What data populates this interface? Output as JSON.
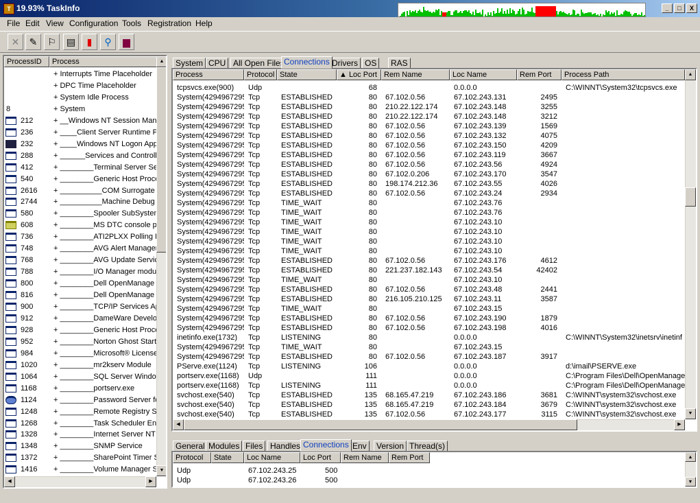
{
  "window": {
    "title": "19.93% TaskInfo",
    "icon": "app-icon",
    "min": "_",
    "max": "□",
    "close": "X"
  },
  "menu": [
    "File",
    "Edit",
    "View",
    "Configuration",
    "Tools",
    "Registration",
    "Help"
  ],
  "toolbar": [
    {
      "name": "close-x-icon",
      "glyph": "✕"
    },
    {
      "name": "pin-icon",
      "glyph": "✎"
    },
    {
      "name": "run-icon",
      "glyph": "⚐"
    },
    {
      "name": "properties-icon",
      "glyph": "▤"
    },
    {
      "name": "color-bars-icon",
      "glyph": "▮"
    },
    {
      "name": "search-icon",
      "glyph": "⚲"
    },
    {
      "name": "book-icon",
      "glyph": "▆"
    }
  ],
  "colors": {
    "graph_green": "#00c000",
    "graph_red": "#ff0000",
    "tab_active": "#1040c0"
  },
  "left": {
    "headers": [
      "ProcessID",
      "Process"
    ],
    "rows": [
      {
        "pid": "",
        "name": "+ Interrupts Time Placeholder",
        "icon": ""
      },
      {
        "pid": "",
        "name": "+ DPC Time Placeholder",
        "icon": ""
      },
      {
        "pid": "",
        "name": "+ System Idle Process",
        "icon": ""
      },
      {
        "pid": "8",
        "name": "+ System",
        "icon": ""
      },
      {
        "pid": "212",
        "name": "+ __Windows NT Session Mana",
        "icon": "window"
      },
      {
        "pid": "236",
        "name": "+ ____Client Server Runtime Pro",
        "icon": "window"
      },
      {
        "pid": "232",
        "name": "+ ____Windows NT Logon App",
        "icon": "lock"
      },
      {
        "pid": "288",
        "name": "+ ______Services and Controlle",
        "icon": "window"
      },
      {
        "pid": "412",
        "name": "+ ________Terminal Server Ser",
        "icon": "window"
      },
      {
        "pid": "540",
        "name": "+ ________Generic Host Proce",
        "icon": "window"
      },
      {
        "pid": "2616",
        "name": "+ __________COM Surrogate",
        "icon": "window"
      },
      {
        "pid": "2744",
        "name": "+ __________Machine Debug M",
        "icon": "window"
      },
      {
        "pid": "580",
        "name": "+ ________Spooler SubSystem",
        "icon": "window"
      },
      {
        "pid": "608",
        "name": "+ ________MS DTC console pr",
        "icon": "gear"
      },
      {
        "pid": "736",
        "name": "+ ________ATI2PLXX Polling P",
        "icon": "window"
      },
      {
        "pid": "748",
        "name": "+ ________AVG Alert Manager",
        "icon": "window"
      },
      {
        "pid": "768",
        "name": "+ ________AVG Update Servic",
        "icon": "window"
      },
      {
        "pid": "788",
        "name": "+ ________I/O Manager module",
        "icon": "window"
      },
      {
        "pid": "800",
        "name": "+ ________Dell OpenManage B",
        "icon": "window"
      },
      {
        "pid": "816",
        "name": "+ ________Dell OpenManage S",
        "icon": "window"
      },
      {
        "pid": "900",
        "name": "+ ________TCP/IP Services Ap",
        "icon": "window"
      },
      {
        "pid": "912",
        "name": "+ ________DameWare Develop",
        "icon": "window"
      },
      {
        "pid": "928",
        "name": "+ ________Generic Host Proce",
        "icon": "window"
      },
      {
        "pid": "952",
        "name": "+ ________Norton Ghost Start",
        "icon": "window"
      },
      {
        "pid": "984",
        "name": "+ ________Microsoft® License",
        "icon": "window"
      },
      {
        "pid": "1020",
        "name": "+ ________mr2kserv Module",
        "icon": "window"
      },
      {
        "pid": "1064",
        "name": "+ ________SQL Server Window",
        "icon": "window"
      },
      {
        "pid": "1168",
        "name": "+ ________portserv.exe",
        "icon": "window"
      },
      {
        "pid": "1124",
        "name": "+ ________Password Server for",
        "icon": "globe"
      },
      {
        "pid": "1248",
        "name": "+ ________Remote Registry Se",
        "icon": "window"
      },
      {
        "pid": "1268",
        "name": "+ ________Task Scheduler Eng",
        "icon": "window"
      },
      {
        "pid": "1328",
        "name": "+ ________Internet Server NT S",
        "icon": "window"
      },
      {
        "pid": "1348",
        "name": "+ ________SNMP Service",
        "icon": "window"
      },
      {
        "pid": "1372",
        "name": "+ ________SharePoint Timer Se",
        "icon": "window"
      },
      {
        "pid": "1416",
        "name": "+ ________Volume Manager Se",
        "icon": "window"
      }
    ]
  },
  "top_tabs": [
    "System",
    "CPU",
    "All Open Files",
    "Connections",
    "Drivers",
    "OS",
    "RAS"
  ],
  "top_active": "Connections",
  "conn": {
    "headers": [
      "Process",
      "Protocol",
      "State",
      "▲ Loc Port",
      "Rem Name",
      "Loc Name",
      "Rem Port",
      "Process Path"
    ],
    "rows": [
      [
        "tcpsvcs.exe(900)",
        "Udp",
        "",
        "68",
        "",
        "0.0.0.0",
        "",
        "C:\\WINNT\\System32\\tcpsvcs.exe"
      ],
      [
        "System(4294967295",
        "Tcp",
        "ESTABLISHED",
        "80",
        "67.102.0.56",
        "67.102.243.131",
        "2495",
        ""
      ],
      [
        "System(4294967295",
        "Tcp",
        "ESTABLISHED",
        "80",
        "210.22.122.174",
        "67.102.243.148",
        "3255",
        ""
      ],
      [
        "System(4294967295",
        "Tcp",
        "ESTABLISHED",
        "80",
        "210.22.122.174",
        "67.102.243.148",
        "3212",
        ""
      ],
      [
        "System(4294967295",
        "Tcp",
        "ESTABLISHED",
        "80",
        "67.102.0.56",
        "67.102.243.139",
        "1569",
        ""
      ],
      [
        "System(4294967295",
        "Tcp",
        "ESTABLISHED",
        "80",
        "67.102.0.56",
        "67.102.243.132",
        "4075",
        ""
      ],
      [
        "System(4294967295",
        "Tcp",
        "ESTABLISHED",
        "80",
        "67.102.0.56",
        "67.102.243.150",
        "4209",
        ""
      ],
      [
        "System(4294967295",
        "Tcp",
        "ESTABLISHED",
        "80",
        "67.102.0.56",
        "67.102.243.119",
        "3667",
        ""
      ],
      [
        "System(4294967295",
        "Tcp",
        "ESTABLISHED",
        "80",
        "67.102.0.56",
        "67.102.243.56",
        "4924",
        ""
      ],
      [
        "System(4294967295",
        "Tcp",
        "ESTABLISHED",
        "80",
        "67.102.0.206",
        "67.102.243.170",
        "3547",
        ""
      ],
      [
        "System(4294967295",
        "Tcp",
        "ESTABLISHED",
        "80",
        "198.174.212.36",
        "67.102.243.55",
        "4026",
        ""
      ],
      [
        "System(4294967295",
        "Tcp",
        "ESTABLISHED",
        "80",
        "67.102.0.56",
        "67.102.243.24",
        "2934",
        ""
      ],
      [
        "System(4294967295",
        "Tcp",
        "TIME_WAIT",
        "80",
        "",
        "67.102.243.76",
        "",
        ""
      ],
      [
        "System(4294967295",
        "Tcp",
        "TIME_WAIT",
        "80",
        "",
        "67.102.243.76",
        "",
        ""
      ],
      [
        "System(4294967295",
        "Tcp",
        "TIME_WAIT",
        "80",
        "",
        "67.102.243.10",
        "",
        ""
      ],
      [
        "System(4294967295",
        "Tcp",
        "TIME_WAIT",
        "80",
        "",
        "67.102.243.10",
        "",
        ""
      ],
      [
        "System(4294967295",
        "Tcp",
        "TIME_WAIT",
        "80",
        "",
        "67.102.243.10",
        "",
        ""
      ],
      [
        "System(4294967295",
        "Tcp",
        "TIME_WAIT",
        "80",
        "",
        "67.102.243.10",
        "",
        ""
      ],
      [
        "System(4294967295",
        "Tcp",
        "ESTABLISHED",
        "80",
        "67.102.0.56",
        "67.102.243.176",
        "4612",
        ""
      ],
      [
        "System(4294967295",
        "Tcp",
        "ESTABLISHED",
        "80",
        "221.237.182.143",
        "67.102.243.54",
        "42402",
        ""
      ],
      [
        "System(4294967295",
        "Tcp",
        "TIME_WAIT",
        "80",
        "",
        "67.102.243.10",
        "",
        ""
      ],
      [
        "System(4294967295",
        "Tcp",
        "ESTABLISHED",
        "80",
        "67.102.0.56",
        "67.102.243.48",
        "2441",
        ""
      ],
      [
        "System(4294967295",
        "Tcp",
        "ESTABLISHED",
        "80",
        "216.105.210.125",
        "67.102.243.11",
        "3587",
        ""
      ],
      [
        "System(4294967295",
        "Tcp",
        "TIME_WAIT",
        "80",
        "",
        "67.102.243.15",
        "",
        ""
      ],
      [
        "System(4294967295",
        "Tcp",
        "ESTABLISHED",
        "80",
        "67.102.0.56",
        "67.102.243.190",
        "1879",
        ""
      ],
      [
        "System(4294967295",
        "Tcp",
        "ESTABLISHED",
        "80",
        "67.102.0.56",
        "67.102.243.198",
        "4016",
        ""
      ],
      [
        "inetinfo.exe(1732)",
        "Tcp",
        "LISTENING",
        "80",
        "",
        "0.0.0.0",
        "",
        "C:\\WINNT\\System32\\inetsrv\\inetinf"
      ],
      [
        "System(4294967295",
        "Tcp",
        "TIME_WAIT",
        "80",
        "",
        "67.102.243.15",
        "",
        ""
      ],
      [
        "System(4294967295",
        "Tcp",
        "ESTABLISHED",
        "80",
        "67.102.0.56",
        "67.102.243.187",
        "3917",
        ""
      ],
      [
        "PServe.exe(1124)",
        "Tcp",
        "LISTENING",
        "106",
        "",
        "0.0.0.0",
        "",
        "d:\\imail\\PSERVE.exe"
      ],
      [
        "portserv.exe(1168)",
        "Udp",
        "",
        "111",
        "",
        "0.0.0.0",
        "",
        "C:\\Program Files\\Dell\\OpenManage"
      ],
      [
        "portserv.exe(1168)",
        "Tcp",
        "LISTENING",
        "111",
        "",
        "0.0.0.0",
        "",
        "C:\\Program Files\\Dell\\OpenManage"
      ],
      [
        "svchost.exe(540)",
        "Tcp",
        "ESTABLISHED",
        "135",
        "68.165.47.219",
        "67.102.243.186",
        "3681",
        "C:\\WINNT\\system32\\svchost.exe"
      ],
      [
        "svchost.exe(540)",
        "Tcp",
        "ESTABLISHED",
        "135",
        "68.165.47.219",
        "67.102.243.184",
        "3679",
        "C:\\WINNT\\system32\\svchost.exe"
      ],
      [
        "svchost.exe(540)",
        "Tcp",
        "ESTABLISHED",
        "135",
        "67.102.0.56",
        "67.102.243.177",
        "3115",
        "C:\\WINNT\\system32\\svchost.exe"
      ]
    ]
  },
  "bottom_tabs": [
    "General",
    "Modules",
    "Files",
    "Handles",
    "Connections",
    "Env",
    "Version",
    "Thread(s)"
  ],
  "bottom_active": "Connections",
  "bconn": {
    "headers": [
      "Protocol",
      "State",
      "Loc Name",
      "Loc Port",
      "Rem Name",
      "Rem Port"
    ],
    "rows": [
      [
        "Udp",
        "",
        "67.102.243.25",
        "500",
        "",
        ""
      ],
      [
        "Udp",
        "",
        "67.102.243.26",
        "500",
        "",
        ""
      ]
    ]
  }
}
